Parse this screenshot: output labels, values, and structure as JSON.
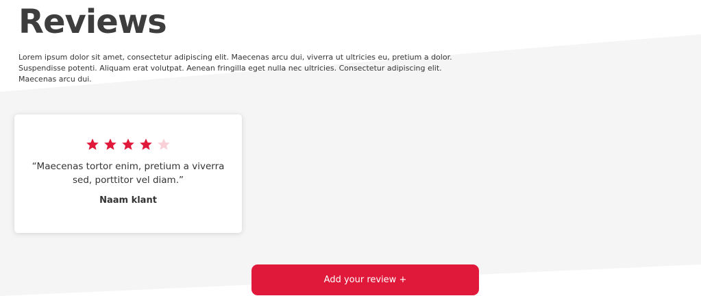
{
  "section": {
    "title": "Reviews",
    "intro": "Lorem ipsum dolor sit amet, consectetur adipiscing elit. Maecenas arcu dui, viverra ut ultricies eu, pretium a dolor. Suspendisse potenti. Aliquam erat volutpat. Aenean fringilla eget nulla nec ultricies. Consectetur adipiscing elit. Maecenas arcu dui."
  },
  "reviews": [
    {
      "rating": 4,
      "max_rating": 5,
      "quote": "“Maecenas tortor enim, pretium a viverra sed, porttitor vel diam.”",
      "author": "Naam klant"
    }
  ],
  "actions": {
    "add_review_label": "Add your review +"
  },
  "colors": {
    "accent": "#e0193a",
    "star_filled": "#e0193a",
    "star_empty": "#f9d0d7",
    "background_shape": "#f5f5f5",
    "title": "#3d3d3d",
    "text": "#333333"
  },
  "icons": {
    "star": "star-icon"
  }
}
